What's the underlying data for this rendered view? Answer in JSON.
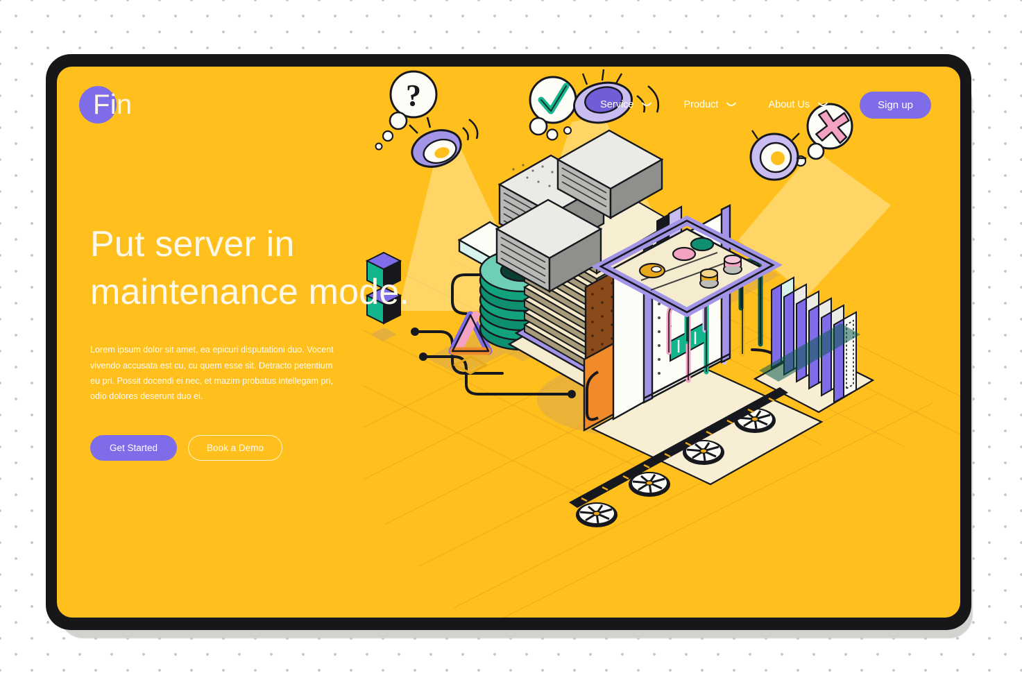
{
  "page": {
    "background_color": "#ffffff",
    "dot_color": "#c9c9c9",
    "screen_color": "#ffc01e",
    "accent_purple": "#7f6ce8",
    "cream": "#fdf8e9"
  },
  "header": {
    "logo": {
      "text": "Fin",
      "circle_color": "#7f6ce8"
    },
    "nav": [
      {
        "label": "Service",
        "icon": "chevron-down-icon"
      },
      {
        "label": "Product",
        "icon": "chevron-down-icon"
      },
      {
        "label": "About Us",
        "icon": "chevron-down-icon"
      }
    ],
    "signup_label": "Sign up"
  },
  "hero": {
    "title": "Put server in maintenance mode.",
    "paragraph": "Lorem ipsum dolor sit amet, ea epicuri disputationi duo. Vocent vivendo accusata est cu, cu quem esse sit. Detracto petentium eu pri. Possit docendi ei nec, et mazim probatus intellegam pri, odio dolores deserunt duo ei.",
    "primary_button": "Get Started",
    "secondary_button": "Book a Demo"
  },
  "illustration": {
    "name": "isometric-server-maintenance-illustration",
    "elements": [
      {
        "name": "thought-bubble-question",
        "symbol": "?"
      },
      {
        "name": "thought-bubble-check",
        "symbol": "check"
      },
      {
        "name": "thought-bubble-cross",
        "symbol": "x"
      },
      {
        "name": "spotlight-left",
        "symbol": "lamp"
      },
      {
        "name": "spotlight-center",
        "symbol": "lamp"
      },
      {
        "name": "spotlight-right",
        "symbol": "lamp"
      },
      {
        "name": "server-rack-main"
      },
      {
        "name": "server-tray-stack"
      },
      {
        "name": "server-blade-stack"
      },
      {
        "name": "cable-coil"
      },
      {
        "name": "network-boxes"
      },
      {
        "name": "isometric-cubes"
      },
      {
        "name": "triangle-prop"
      },
      {
        "name": "floor-fans",
        "count": 4
      }
    ],
    "palette": {
      "purple": "#8a7ae0",
      "purple_dark": "#5b4aa8",
      "teal": "#12a27e",
      "pink": "#f2a6c0",
      "orange": "#f08a2a",
      "cream": "#f5ecd0",
      "outline": "#16181d"
    }
  }
}
